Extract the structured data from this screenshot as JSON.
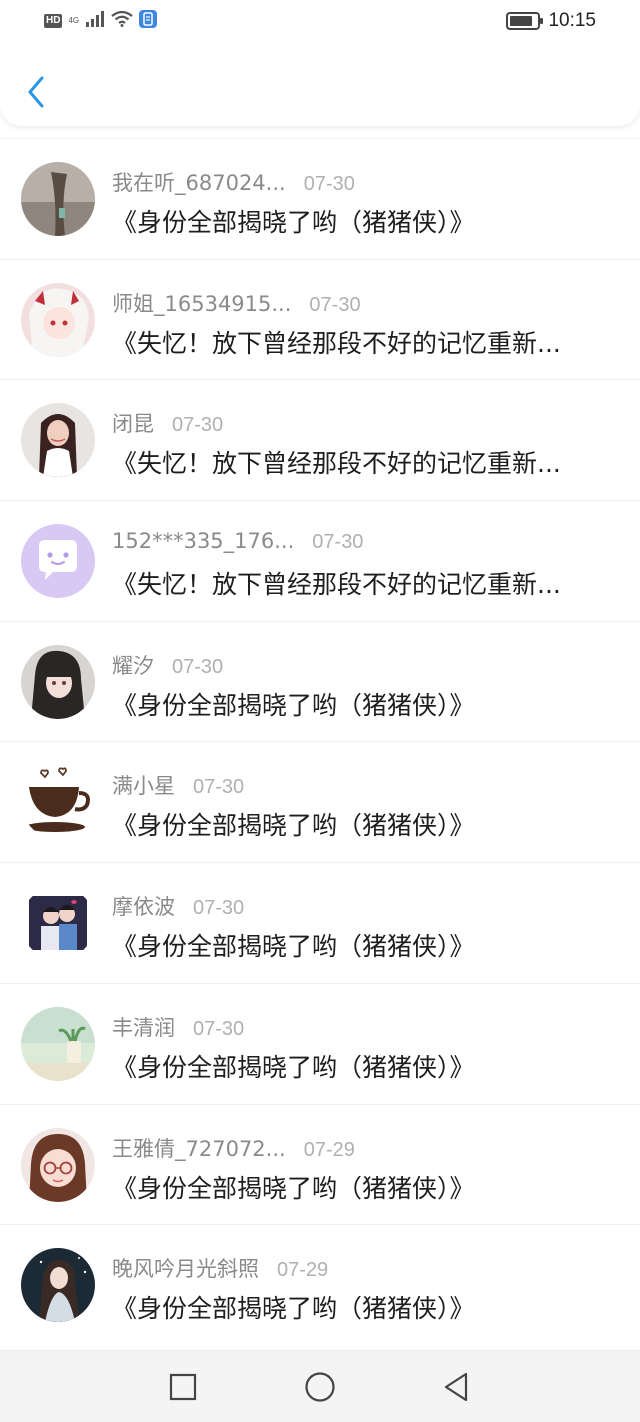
{
  "status_bar": {
    "hd": "HD",
    "network": "4G",
    "time": "10:15"
  },
  "colors": {
    "accent": "#2a96e6",
    "username": "#8a8a8a",
    "date": "#b0b0b0"
  },
  "header": {
    "back_icon": "chevron-left-icon"
  },
  "items": [
    {
      "name": "我在听_687024...",
      "date": "07-30",
      "title": "《身份全部揭晓了哟（猪猪侠）》",
      "avatar": "avatar-tree"
    },
    {
      "name": "师姐_16534915...",
      "date": "07-30",
      "title": "《失忆！放下曾经那段不好的记忆重新...",
      "avatar": "avatar-anime-girl"
    },
    {
      "name": "闭昆",
      "date": "07-30",
      "title": "《失忆！放下曾经那段不好的记忆重新...",
      "avatar": "avatar-photo-girl"
    },
    {
      "name": "152***335_176...",
      "date": "07-30",
      "title": "《失忆！放下曾经那段不好的记忆重新...",
      "avatar": "avatar-default-chat"
    },
    {
      "name": "耀汐",
      "date": "07-30",
      "title": "《身份全部揭晓了哟（猪猪侠）》",
      "avatar": "avatar-dark-hair"
    },
    {
      "name": "满小星",
      "date": "07-30",
      "title": "《身份全部揭晓了哟（猪猪侠）》",
      "avatar": "avatar-coffee-cup"
    },
    {
      "name": "摩依波",
      "date": "07-30",
      "title": "《身份全部揭晓了哟（猪猪侠）》",
      "avatar": "avatar-couple"
    },
    {
      "name": "丰清润",
      "date": "07-30",
      "title": "《身份全部揭晓了哟（猪猪侠）》",
      "avatar": "avatar-plant"
    },
    {
      "name": "王雅倩_727072...",
      "date": "07-29",
      "title": "《身份全部揭晓了哟（猪猪侠）》",
      "avatar": "avatar-glasses-girl"
    },
    {
      "name": "晚风吟月光斜照",
      "date": "07-29",
      "title": "《身份全部揭晓了哟（猪猪侠）》",
      "avatar": "avatar-night-girl"
    }
  ],
  "nav_bar": {
    "recent": "square-icon",
    "home": "circle-icon",
    "back": "triangle-back-icon"
  }
}
